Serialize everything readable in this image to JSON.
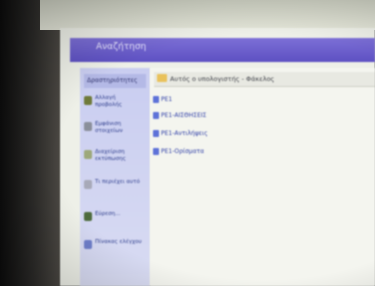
{
  "window": {
    "title": "Αναζήτηση"
  },
  "sidebar": {
    "header": "Δραστηριότητες",
    "items": [
      {
        "label": "Αλλαγή προβολής",
        "icon": "view-icon",
        "color": "#6f7a3a"
      },
      {
        "label": "Εμφάνιση στοιχείων",
        "icon": "details-icon",
        "color": "#8a8f9a"
      },
      {
        "label": "Διαχείριση εκτύπωσης",
        "icon": "printer-icon",
        "color": "#9da87a"
      },
      {
        "label": "Τι περιέχει αυτό",
        "icon": "document-icon",
        "color": "#a7a9b8"
      },
      {
        "label": "Εύρεση...",
        "icon": "search-icon",
        "color": "#4d6b3c"
      },
      {
        "label": "Πίνακας ελέγχου",
        "icon": "control-panel-icon",
        "color": "#6e7ec9"
      }
    ]
  },
  "address": {
    "text": "Αυτός ο υπολογιστής - Φάκελος"
  },
  "files": [
    {
      "name": "ΡΕ1"
    },
    {
      "name": "ΡΕ1-ΑΙΣΘΗΣΕΙΣ"
    },
    {
      "name": "ΡΕ1-Αντιλήψεις"
    },
    {
      "name": "ΡΕ1-Ορίσματα"
    }
  ]
}
